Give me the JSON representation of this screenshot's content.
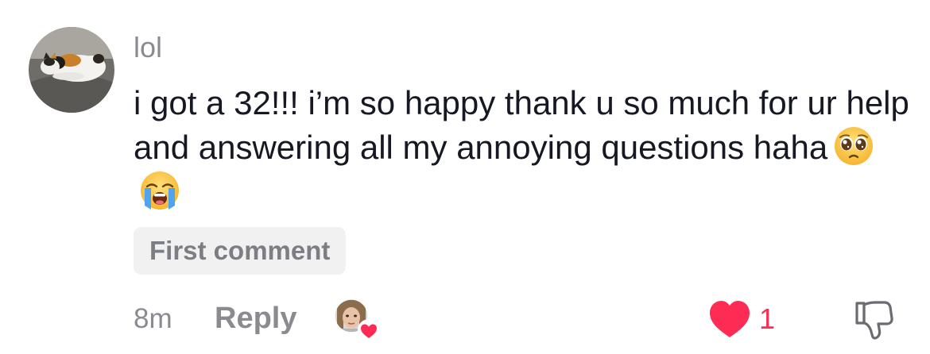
{
  "comment": {
    "username": "lol",
    "text": "i got a 32!!! i’m so happy thank u so much for ur help and answering all my annoying questions haha",
    "emojis": [
      "pleading-face-emoji",
      "loudly-crying-face-emoji"
    ],
    "badge": "First comment",
    "time": "8m",
    "reply_label": "Reply",
    "like_count": "1",
    "liked_by_creator": true,
    "liked": true
  },
  "colors": {
    "like_red": "#fe2c55",
    "muted_text": "#8a8b91",
    "badge_bg": "#f1f1f2"
  },
  "icons": {
    "like": "heart-icon",
    "dislike": "thumbs-down-icon"
  }
}
